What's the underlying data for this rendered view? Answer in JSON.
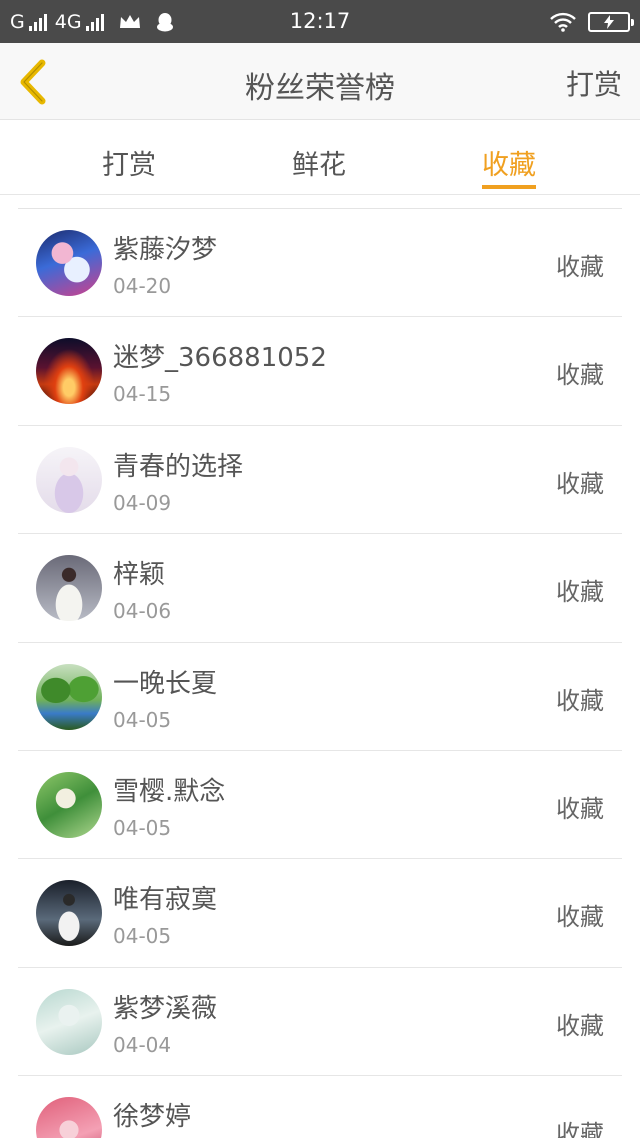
{
  "status_bar": {
    "carrier1": "G",
    "carrier2": "4G",
    "time": "12:17"
  },
  "header": {
    "title": "粉丝荣誉榜",
    "right_action": "打赏",
    "back_icon": "chevron-left-icon",
    "accent_color": "#e8b800"
  },
  "tabs": [
    {
      "label": "打赏",
      "active": false
    },
    {
      "label": "鲜花",
      "active": false
    },
    {
      "label": "收藏",
      "active": true
    }
  ],
  "tab_active_color": "#f0a020",
  "fans": [
    {
      "name": "紫藤汐梦",
      "date": "04-20",
      "action": "收藏"
    },
    {
      "name": "迷梦_366881052",
      "date": "04-15",
      "action": "收藏"
    },
    {
      "name": "青春的选择",
      "date": "04-09",
      "action": "收藏"
    },
    {
      "name": "梓颖",
      "date": "04-06",
      "action": "收藏"
    },
    {
      "name": "一晚长夏",
      "date": "04-05",
      "action": "收藏"
    },
    {
      "name": "雪樱.默念",
      "date": "04-05",
      "action": "收藏"
    },
    {
      "name": "唯有寂寞",
      "date": "04-05",
      "action": "收藏"
    },
    {
      "name": "紫梦溪薇",
      "date": "04-04",
      "action": "收藏"
    },
    {
      "name": "徐梦婷",
      "date": "",
      "action": "收藏"
    }
  ]
}
